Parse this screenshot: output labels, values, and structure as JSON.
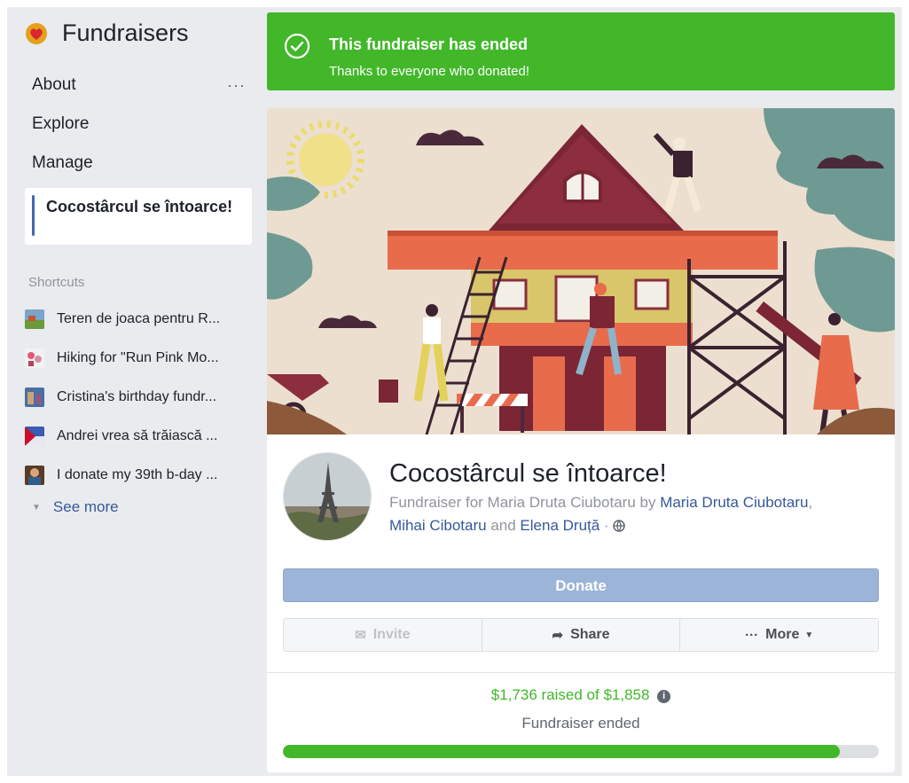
{
  "app": {
    "title": "Fundraisers"
  },
  "sidebar": {
    "nav": [
      {
        "label": "About",
        "has_menu": true
      },
      {
        "label": "Explore"
      },
      {
        "label": "Manage"
      }
    ],
    "active_item": "Cocostârcul se întoarce!",
    "shortcuts_label": "Shortcuts",
    "shortcuts": [
      {
        "label": "Teren de joaca pentru R..."
      },
      {
        "label": "Hiking for \"Run Pink Mo..."
      },
      {
        "label": "Cristina's birthday fundr..."
      },
      {
        "label": "Andrei vrea să trăiască ..."
      },
      {
        "label": "I donate my 39th b-day ..."
      }
    ],
    "see_more": "See more",
    "menu_dots": "···"
  },
  "banner": {
    "title": "This fundraiser has ended",
    "subtitle": "Thanks to everyone who donated!"
  },
  "fundraiser": {
    "title": "Cocostârcul se întoarce!",
    "sub_prefix": "Fundraiser for Maria Druta Ciubotaru by ",
    "organizer1": "Maria Druta Ciubotaru",
    "sep": ", ",
    "organizer2": "Mihai Cibotaru",
    "and": " and ",
    "organizer3": "Elena Druță",
    "dot": " · ",
    "donate_label": "Donate",
    "invite_label": "Invite",
    "share_label": "Share",
    "more_label": "More",
    "raised_text": "$1,736 raised of $1,858",
    "status": "Fundraiser ended",
    "progress": 0.934
  },
  "colors": {
    "success": "#42b72a",
    "link": "#365899",
    "accent": "#4267b2"
  }
}
